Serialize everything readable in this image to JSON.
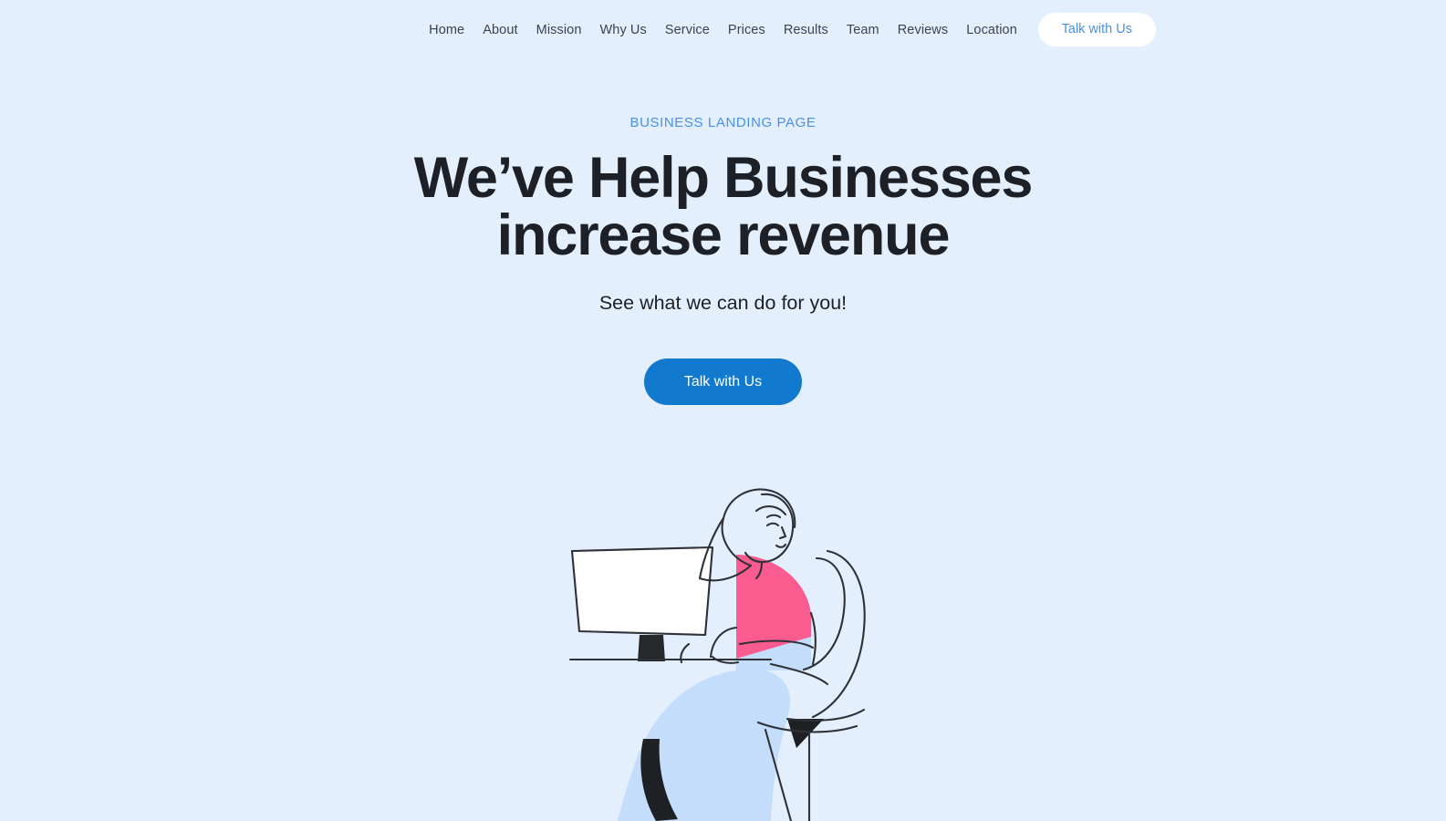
{
  "page": {
    "background_color": "#e4effd"
  },
  "header": {
    "nav_items": [
      {
        "label": "Home",
        "name": "nav-home"
      },
      {
        "label": "About",
        "name": "nav-about"
      },
      {
        "label": "Mission",
        "name": "nav-mission"
      },
      {
        "label": "Why Us",
        "name": "nav-why-us"
      },
      {
        "label": "Service",
        "name": "nav-service"
      },
      {
        "label": "Prices",
        "name": "nav-prices"
      },
      {
        "label": "Results",
        "name": "nav-results"
      },
      {
        "label": "Team",
        "name": "nav-team"
      },
      {
        "label": "Reviews",
        "name": "nav-reviews"
      },
      {
        "label": "Location",
        "name": "nav-location"
      }
    ],
    "cta_label": "Talk with Us",
    "cta_text_color": "#4a90e8",
    "cta_background_color": "#ffffff"
  },
  "hero": {
    "eyebrow": "BUSINESS LANDING PAGE",
    "eyebrow_color": "#4a90e8",
    "headline_line1": "We’ve Help Businesses",
    "headline_line2": "increase revenue",
    "headline_color": "#1d2026",
    "subhead": "See what we can do for you!",
    "cta_label": "Talk with Us",
    "cta_background_color": "#1179ce",
    "cta_text_color": "#ffffff"
  },
  "illustration": {
    "alt": "woman-at-desk-illustration",
    "colors": {
      "shirt_pink": "#fb5c8f",
      "pants_light_blue": "#c4ddfb",
      "shoe_dark": "#1f2024",
      "monitor_screen": "#ffffff",
      "monitor_stand": "#27282c",
      "line_stroke": "#2e3137"
    }
  }
}
